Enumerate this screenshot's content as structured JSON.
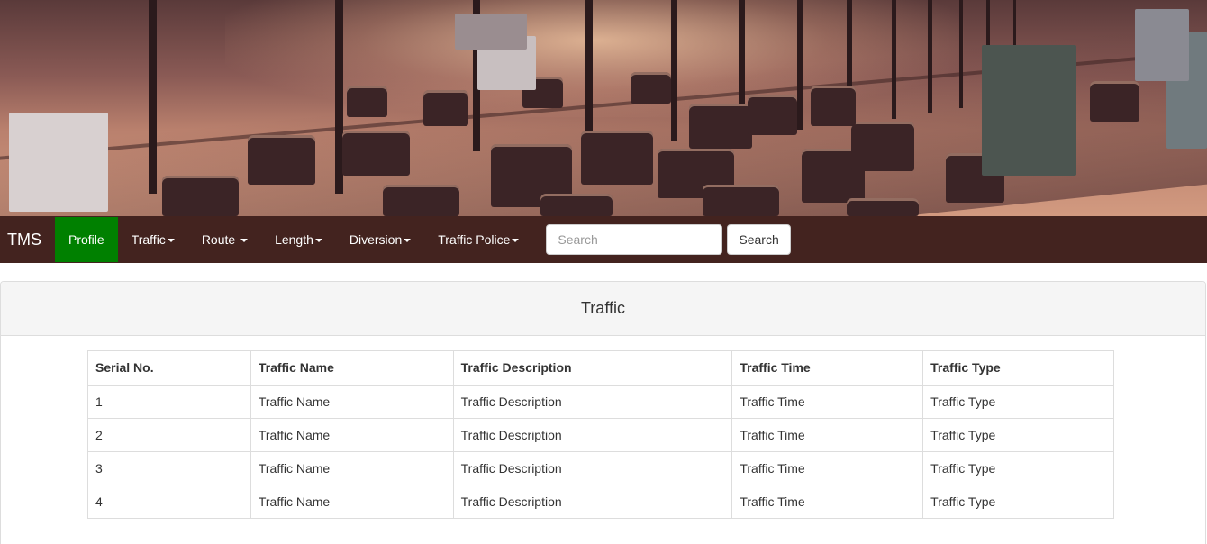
{
  "navbar": {
    "brand": "TMS",
    "items": [
      {
        "label": "Profile",
        "dropdown": false,
        "active": true
      },
      {
        "label": "Traffic",
        "dropdown": true
      },
      {
        "label": "Route ",
        "dropdown": true
      },
      {
        "label": "Length",
        "dropdown": true
      },
      {
        "label": "Diversion",
        "dropdown": true
      },
      {
        "label": "Traffic Police",
        "dropdown": true
      }
    ],
    "search_placeholder": "Search",
    "search_button": "Search",
    "brand_color": "#43231f",
    "active_color": "#008000"
  },
  "panel": {
    "title": "Traffic"
  },
  "table": {
    "headers": [
      "Serial No.",
      "Traffic Name",
      "Traffic Description",
      "Traffic Time",
      "Traffic Type"
    ],
    "rows": [
      [
        "1",
        "Traffic Name",
        "Traffic Description",
        "Traffic Time",
        "Traffic Type"
      ],
      [
        "2",
        "Traffic Name",
        "Traffic Description",
        "Traffic Time",
        "Traffic Type"
      ],
      [
        "3",
        "Traffic Name",
        "Traffic Description",
        "Traffic Time",
        "Traffic Type"
      ],
      [
        "4",
        "Traffic Name",
        "Traffic Description",
        "Traffic Time",
        "Traffic Type"
      ]
    ]
  }
}
